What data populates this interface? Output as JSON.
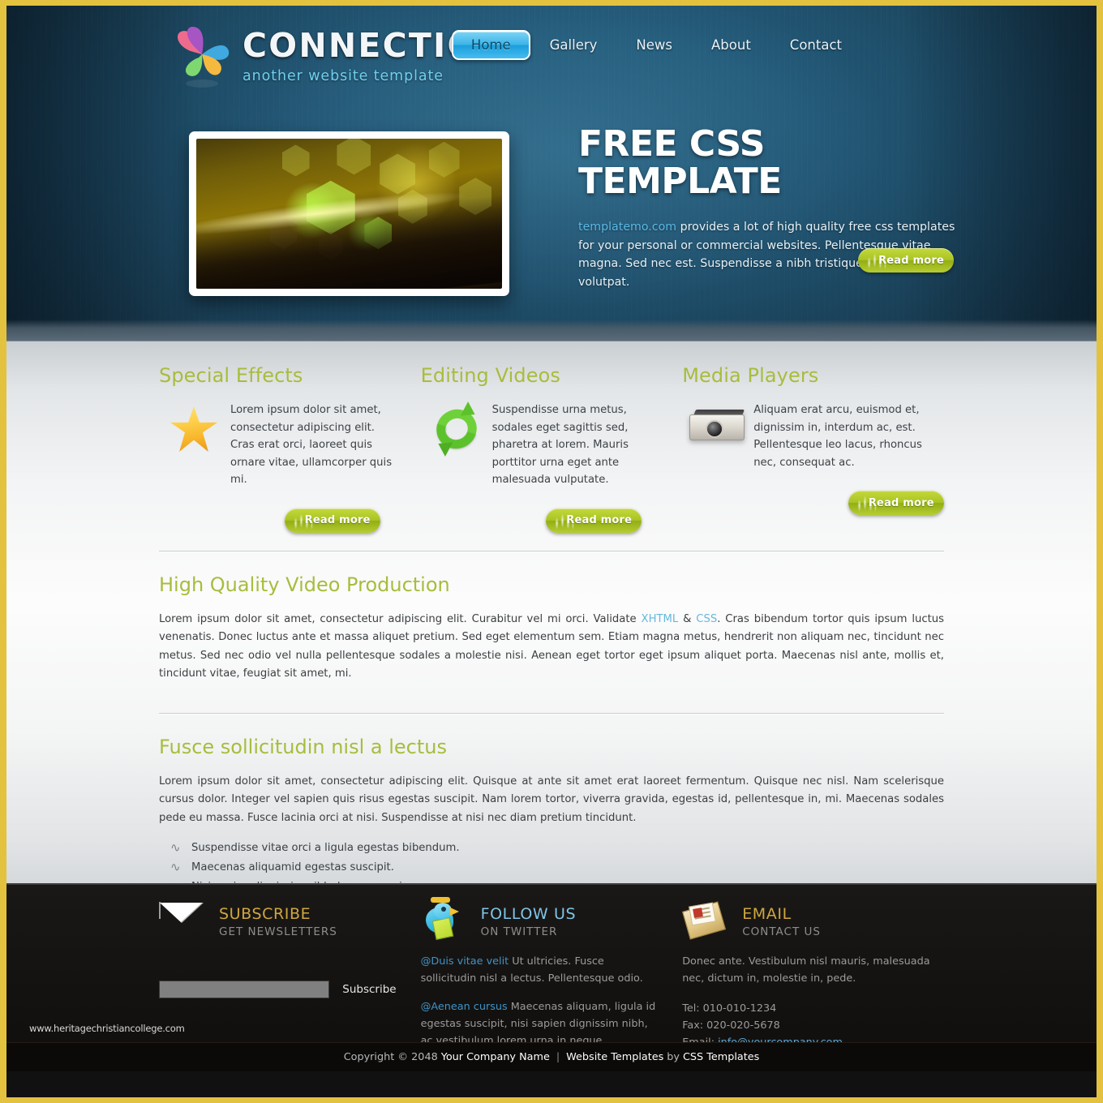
{
  "site": {
    "logo_title": "CONNECTION",
    "logo_subtitle": "another website template"
  },
  "nav": {
    "items": [
      {
        "label": "Home",
        "active": true
      },
      {
        "label": "Gallery",
        "active": false
      },
      {
        "label": "News",
        "active": false
      },
      {
        "label": "About",
        "active": false
      },
      {
        "label": "Contact",
        "active": false
      }
    ]
  },
  "hero": {
    "heading": "FREE CSS TEMPLATE",
    "link_text": "templatemo.com",
    "body": " provides a lot of high quality free css templates for your personal or commercial websites. Pellentesque vitae magna. Sed nec est. Suspendisse a nibh tristique justo rhoncus volutpat.",
    "read_more": "Read more",
    "image_alt": "abstract-hexagon-bokeh"
  },
  "features": [
    {
      "title": "Special Effects",
      "icon": "star-icon",
      "text": "Lorem ipsum dolor sit amet, consectetur adipiscing elit. Cras erat orci, laoreet quis ornare vitae, ullamcorper quis mi.",
      "read_more": "Read more"
    },
    {
      "title": "Editing Videos",
      "icon": "recycle-icon",
      "text": "Suspendisse urna metus, sodales eget sagittis sed, pharetra at lorem. Mauris porttitor urna eget ante malesuada vulputate.",
      "read_more": "Read more"
    },
    {
      "title": "Media Players",
      "icon": "projector-icon",
      "text": "Aliquam erat arcu, euismod et, dignissim in, interdum ac, est. Pellentesque leo lacus, rhoncus nec, consequat ac.",
      "read_more": "Read more"
    }
  ],
  "articles": {
    "video": {
      "title": "High Quality Video Production",
      "part1": "Lorem ipsum dolor sit amet, consectetur adipiscing elit. Curabitur vel mi orci. Validate ",
      "link1": "XHTML",
      "amp": " & ",
      "link2": "CSS",
      "part2": ". Cras bibendum tortor quis ipsum luctus venenatis. Donec luctus ante et massa aliquet pretium. Sed eget elementum sem. Etiam magna metus, hendrerit non aliquam nec, tincidunt nec metus. Sed nec odio vel nulla pellentesque sodales a molestie nisi. Aenean eget tortor eget ipsum aliquet porta. Maecenas nisl ante, mollis et, tincidunt vitae, feugiat sit amet, mi."
    },
    "fusce": {
      "title": "Fusce sollicitudin nisl a lectus",
      "body": "Lorem ipsum dolor sit amet, consectetur adipiscing elit. Quisque at ante sit amet erat laoreet fermentum. Quisque nec nisl. Nam scelerisque cursus dolor. Integer vel sapien quis risus egestas suscipit. Nam lorem tortor, viverra gravida, egestas id, pellentesque in, mi. Maecenas sodales pede eu massa. Fusce lacinia orci at nisi. Suspendisse at nisi nec diam pretium tincidunt.",
      "list": [
        "Suspendisse vitae orci a ligula egestas bibendum.",
        "Maecenas aliquamid egestas suscipit.",
        "Nisi sapien dignissim nibh, lorem urna in neque."
      ]
    }
  },
  "footer": {
    "subscribe": {
      "icon": "envelope-icon",
      "title": "SUBSCRIBE",
      "subtitle": "GET NEWSLETTERS",
      "input_value": "",
      "input_placeholder": "",
      "button_label": "Subscribe"
    },
    "twitter": {
      "icon": "twitter-bird-icon",
      "title": "FOLLOW US",
      "subtitle": "ON TWITTER",
      "tweets": [
        {
          "handle": "@Duis vitae velit",
          "text": " Ut ultricies. Fusce sollicitudin nisl a lectus. Pellentesque odio."
        },
        {
          "handle": "@Aenean cursus",
          "text": " Maecenas aliquam, ligula id egestas suscipit, nisi sapien dignissim nibh, ac vestibulum lorem urna in neque."
        }
      ]
    },
    "email": {
      "icon": "mail-stack-icon",
      "title": "EMAIL",
      "subtitle": "CONTACT US",
      "text": "Donec ante. Vestibulum nisl mauris, malesuada nec, dictum in, molestie in, pede.",
      "tel": "Tel: 010-010-1234",
      "fax": "Fax: 020-020-5678",
      "email_label": "Email: ",
      "email_value": "info@yourcompany.com"
    },
    "watermark": "www.heritagechristiancollege.com",
    "copyright": {
      "prefix": "Copyright © 2048 ",
      "company": "Your Company Name",
      "sep": "|",
      "templates_link": "Website Templates",
      "by": " by ",
      "css_link": "CSS Templates"
    }
  },
  "colors": {
    "border_gold": "#e3c240",
    "accent_green": "#a7bd3c",
    "link_blue": "#59b9e6",
    "nav_active": "#39b3e8"
  }
}
